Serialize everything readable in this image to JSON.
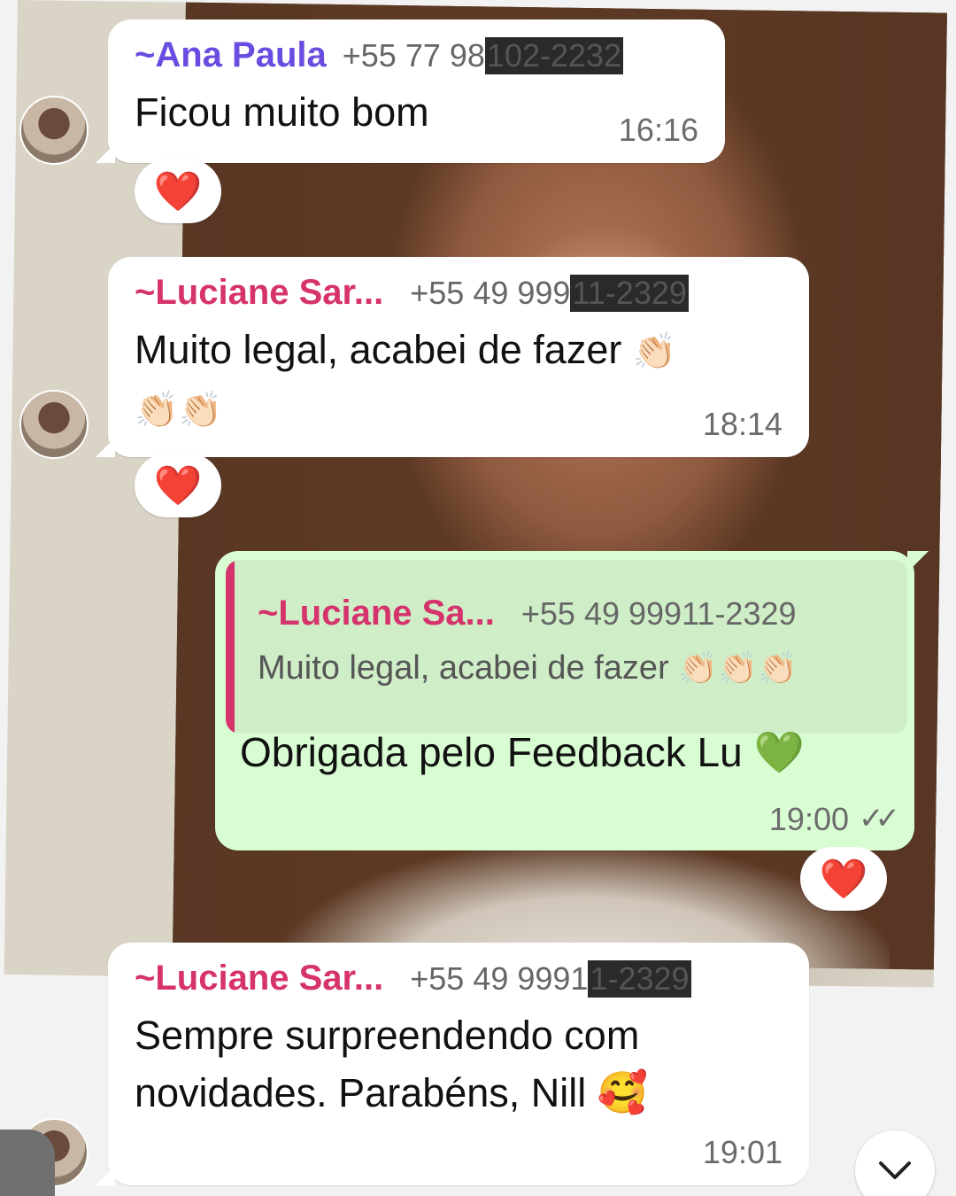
{
  "colors": {
    "ana_name": "#6a4de0",
    "luciane_name": "#d6336c",
    "outgoing_bg": "#d9fdd3",
    "reaction_heart": "#e0192f"
  },
  "messages": [
    {
      "sender": "~Ana Paula",
      "phone_visible": "+55 77 98",
      "phone_redacted": "102-2232",
      "text": "Ficou muito bom",
      "time": "16:16",
      "reaction": "❤️"
    },
    {
      "sender": "~Luciane Sar...",
      "phone_visible": "+55 49 999",
      "phone_redacted": "11-2329",
      "text_line1": "Muito legal, acabei de fazer",
      "emoji1": "👏🏻",
      "emoji2": "👏🏻👏🏻",
      "time": "18:14",
      "reaction": "❤️"
    },
    {
      "quoted_sender": "~Luciane Sa...",
      "quoted_phone": "+55 49 99911-2329",
      "quoted_text": "Muito legal, acabei de fazer",
      "quoted_emoji": "👏🏻👏🏻👏🏻",
      "text": "Obrigada pelo Feedback Lu",
      "text_emoji": "💚",
      "time": "19:00",
      "status_icon": "✓✓",
      "reaction": "❤️"
    },
    {
      "sender": "~Luciane Sar...",
      "phone_visible": "+55 49 9991",
      "phone_redacted": "1-2329",
      "text_line1": "Sempre surpreendendo com",
      "text_line2": "novidades. Parabéns, Nill",
      "text_emoji": "🥰",
      "time": "19:01"
    }
  ],
  "scroll_button_icon": "chevron-down-icon"
}
